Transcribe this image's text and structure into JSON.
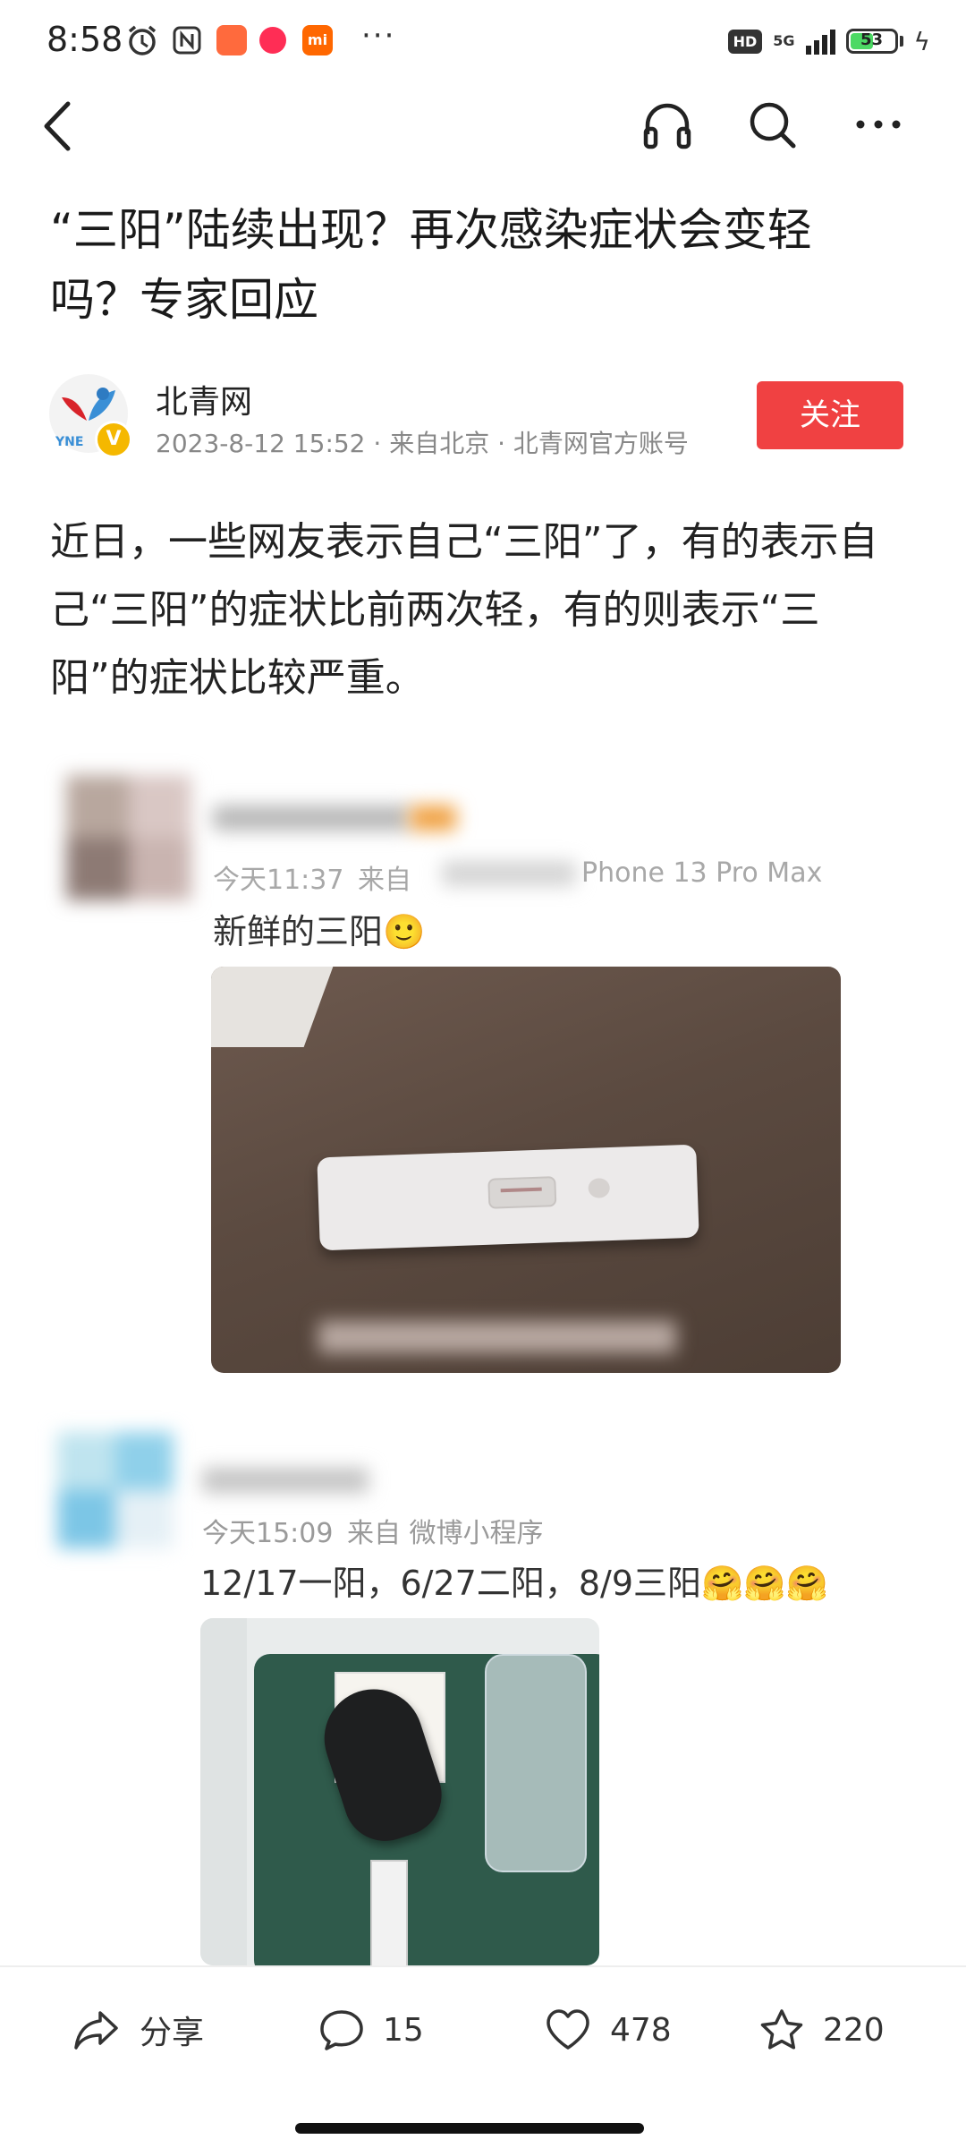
{
  "status_bar": {
    "time": "8:58",
    "network": "5G",
    "hd": "HD",
    "battery": "53",
    "battery_level": 0.53
  },
  "nav": {
    "back_icon": "chevron-left-icon",
    "listen_icon": "headphones-icon",
    "search_icon": "search-icon",
    "more_icon": "more-icon"
  },
  "article": {
    "title": "“三阳”陆续出现？再次感染症状会变轻吗？专家回应",
    "author": {
      "name": "北青网",
      "meta": "2023-8-12 15:52 · 来自北京 · 北青网官方账号",
      "avatar_text": "YNE",
      "verified_badge": "V",
      "follow_label": "关注"
    },
    "intro": "近日，一些网友表示自己“三阳”了，有的表示自己“三阳”的症状比前两次轻，有的则表示“三阳”的症状比较严重。"
  },
  "embedded_posts": [
    {
      "meta_time": "今天11:37",
      "meta_from": "来自",
      "meta_device": "Phone 13 Pro Max",
      "text": "新鲜的三阳",
      "emoji": "🙂"
    },
    {
      "meta_time": "今天15:09",
      "meta_from": "来自 微博小程序",
      "text": "12/17一阳，6/27二阳，8/9三阳",
      "emoji": "🤗🤗🤗"
    }
  ],
  "bottom_bar": {
    "share_label": "分享",
    "comments": "15",
    "likes": "478",
    "favorites": "220"
  },
  "colors": {
    "follow_bg": "#f04142",
    "battery": "#4cd964",
    "verified": "#f5b800"
  }
}
